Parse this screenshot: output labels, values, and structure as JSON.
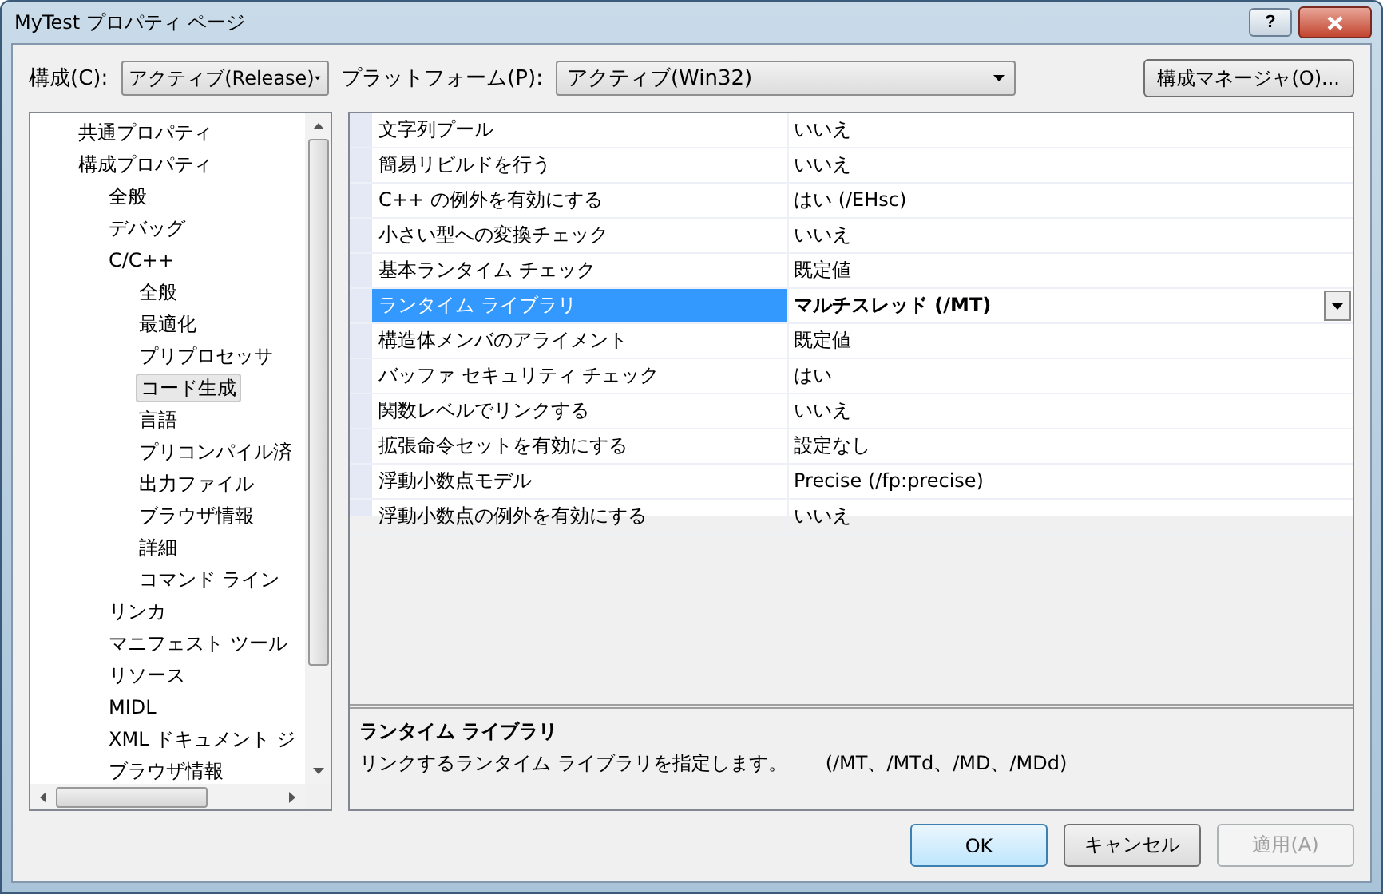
{
  "window": {
    "title": "MyTest プロパティ ページ",
    "help_button": "?"
  },
  "toolbar": {
    "config_label": "構成(C):",
    "config_value": "アクティブ(Release)",
    "platform_label": "プラットフォーム(P):",
    "platform_value": "アクティブ(Win32)",
    "manager_button": "構成マネージャ(O)..."
  },
  "tree": [
    {
      "label": "共通プロパティ",
      "selected": false
    },
    {
      "label": "構成プロパティ",
      "selected": false,
      "children": [
        {
          "label": "全般",
          "selected": false
        },
        {
          "label": "デバッグ",
          "selected": false
        },
        {
          "label": "C/C++",
          "selected": false,
          "children": [
            {
              "label": "全般",
              "selected": false
            },
            {
              "label": "最適化",
              "selected": false
            },
            {
              "label": "プリプロセッサ",
              "selected": false
            },
            {
              "label": "コード生成",
              "selected": true
            },
            {
              "label": "言語",
              "selected": false
            },
            {
              "label": "プリコンパイル済",
              "selected": false
            },
            {
              "label": "出力ファイル",
              "selected": false
            },
            {
              "label": "ブラウザ情報",
              "selected": false
            },
            {
              "label": "詳細",
              "selected": false
            },
            {
              "label": "コマンド ライン",
              "selected": false
            }
          ]
        },
        {
          "label": "リンカ",
          "selected": false
        },
        {
          "label": "マニフェスト ツール",
          "selected": false
        },
        {
          "label": "リソース",
          "selected": false
        },
        {
          "label": "MIDL",
          "selected": false
        },
        {
          "label": "XML ドキュメント ジ",
          "selected": false
        },
        {
          "label": "ブラウザ情報",
          "selected": false
        }
      ]
    }
  ],
  "properties": [
    {
      "name": "文字列プール",
      "value": "いいえ",
      "selected": false
    },
    {
      "name": "簡易リビルドを行う",
      "value": "いいえ",
      "selected": false
    },
    {
      "name": "C++ の例外を有効にする",
      "value": "はい (/EHsc)",
      "selected": false
    },
    {
      "name": "小さい型への変換チェック",
      "value": "いいえ",
      "selected": false
    },
    {
      "name": "基本ランタイム チェック",
      "value": "既定値",
      "selected": false
    },
    {
      "name": "ランタイム ライブラリ",
      "value": "マルチスレッド (/MT)",
      "selected": true
    },
    {
      "name": "構造体メンバのアライメント",
      "value": "既定値",
      "selected": false
    },
    {
      "name": "バッファ セキュリティ チェック",
      "value": "はい",
      "selected": false
    },
    {
      "name": "関数レベルでリンクする",
      "value": "いいえ",
      "selected": false
    },
    {
      "name": "拡張命令セットを有効にする",
      "value": "設定なし",
      "selected": false
    },
    {
      "name": "浮動小数点モデル",
      "value": "Precise (/fp:precise)",
      "selected": false
    },
    {
      "name": "浮動小数点の例外を有効にする",
      "value": "いいえ",
      "selected": false
    }
  ],
  "description": {
    "title": "ランタイム ライブラリ",
    "text": "リンクするランタイム ライブラリを指定します。　　(/MT、/MTd、/MD、/MDd)"
  },
  "buttons": [
    {
      "label": "OK",
      "kind": "default",
      "disabled": false
    },
    {
      "label": "キャンセル",
      "kind": "normal",
      "disabled": false
    },
    {
      "label": "適用(A)",
      "kind": "normal",
      "disabled": true
    }
  ]
}
